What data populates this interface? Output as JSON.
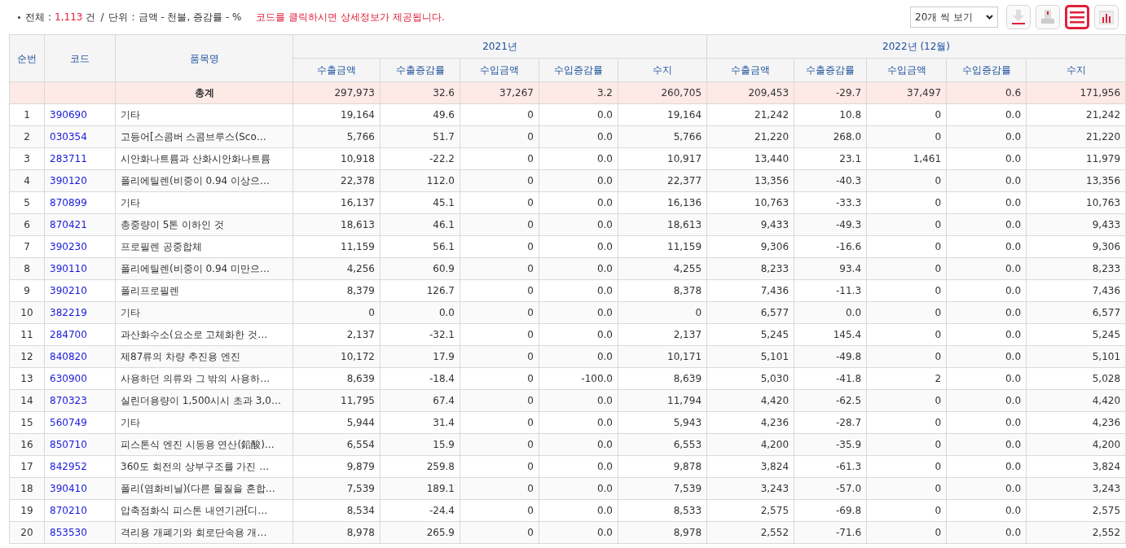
{
  "summary": {
    "total_label": "전체",
    "colon": ":",
    "slash": "/",
    "total_count": "1,113",
    "count_unit": "건",
    "unit_label": "단위",
    "unit_text": "금액 - 천불, 증감률 - %",
    "notice": "코드를 클릭하시면 상세정보가 제공됩니다."
  },
  "page_size_select": {
    "value": "20개 씩 보기"
  },
  "toolbar": [
    {
      "kind": "download",
      "selected": false
    },
    {
      "kind": "print",
      "selected": false
    },
    {
      "kind": "list",
      "selected": true
    },
    {
      "kind": "chart",
      "selected": false
    }
  ],
  "table": {
    "columns": [
      "순번",
      "코드",
      "품목명"
    ],
    "groups": [
      {
        "label": "2021년",
        "columns": [
          "수출금액",
          "수출증감률",
          "수입금액",
          "수입증감률",
          "수지"
        ]
      },
      {
        "label": "2022년 (12월)",
        "columns": [
          "수출금액",
          "수출증감률",
          "수입금액",
          "수입증감률",
          "수지"
        ]
      }
    ],
    "total_row": {
      "label": "총계",
      "values": [
        "297,973",
        "32.6",
        "37,267",
        "3.2",
        "260,705",
        "209,453",
        "-29.7",
        "37,497",
        "0.6",
        "171,956"
      ]
    },
    "rows": [
      {
        "no": "1",
        "code": "390690",
        "name": "기타",
        "values": [
          "19,164",
          "49.6",
          "0",
          "0.0",
          "19,164",
          "21,242",
          "10.8",
          "0",
          "0.0",
          "21,242"
        ]
      },
      {
        "no": "2",
        "code": "030354",
        "name": "고등어[스콤버 스콤브루스(Sco…",
        "values": [
          "5,766",
          "51.7",
          "0",
          "0.0",
          "5,766",
          "21,220",
          "268.0",
          "0",
          "0.0",
          "21,220"
        ]
      },
      {
        "no": "3",
        "code": "283711",
        "name": "시안화나트륨과 산화시안화나트륨",
        "values": [
          "10,918",
          "-22.2",
          "0",
          "0.0",
          "10,917",
          "13,440",
          "23.1",
          "1,461",
          "0.0",
          "11,979"
        ]
      },
      {
        "no": "4",
        "code": "390120",
        "name": "폴리에틸렌(비중이 0.94 이상으…",
        "values": [
          "22,378",
          "112.0",
          "0",
          "0.0",
          "22,377",
          "13,356",
          "-40.3",
          "0",
          "0.0",
          "13,356"
        ]
      },
      {
        "no": "5",
        "code": "870899",
        "name": "기타",
        "values": [
          "16,137",
          "45.1",
          "0",
          "0.0",
          "16,136",
          "10,763",
          "-33.3",
          "0",
          "0.0",
          "10,763"
        ]
      },
      {
        "no": "6",
        "code": "870421",
        "name": "총중량이 5톤 이하인 것",
        "values": [
          "18,613",
          "46.1",
          "0",
          "0.0",
          "18,613",
          "9,433",
          "-49.3",
          "0",
          "0.0",
          "9,433"
        ]
      },
      {
        "no": "7",
        "code": "390230",
        "name": "프로필렌 공중합체",
        "values": [
          "11,159",
          "56.1",
          "0",
          "0.0",
          "11,159",
          "9,306",
          "-16.6",
          "0",
          "0.0",
          "9,306"
        ]
      },
      {
        "no": "8",
        "code": "390110",
        "name": "폴리에틸렌(비중이 0.94 미만으…",
        "values": [
          "4,256",
          "60.9",
          "0",
          "0.0",
          "4,255",
          "8,233",
          "93.4",
          "0",
          "0.0",
          "8,233"
        ]
      },
      {
        "no": "9",
        "code": "390210",
        "name": "폴리프로필렌",
        "values": [
          "8,379",
          "126.7",
          "0",
          "0.0",
          "8,378",
          "7,436",
          "-11.3",
          "0",
          "0.0",
          "7,436"
        ]
      },
      {
        "no": "10",
        "code": "382219",
        "name": "기타",
        "values": [
          "0",
          "0.0",
          "0",
          "0.0",
          "0",
          "6,577",
          "0.0",
          "0",
          "0.0",
          "6,577"
        ]
      },
      {
        "no": "11",
        "code": "284700",
        "name": "과산화수소(요소로 고체화한 것…",
        "values": [
          "2,137",
          "-32.1",
          "0",
          "0.0",
          "2,137",
          "5,245",
          "145.4",
          "0",
          "0.0",
          "5,245"
        ]
      },
      {
        "no": "12",
        "code": "840820",
        "name": "제87류의 차량 추진용 엔진",
        "values": [
          "10,172",
          "17.9",
          "0",
          "0.0",
          "10,171",
          "5,101",
          "-49.8",
          "0",
          "0.0",
          "5,101"
        ]
      },
      {
        "no": "13",
        "code": "630900",
        "name": "사용하던 의류와 그 밖의 사용하…",
        "values": [
          "8,639",
          "-18.4",
          "0",
          "-100.0",
          "8,639",
          "5,030",
          "-41.8",
          "2",
          "0.0",
          "5,028"
        ]
      },
      {
        "no": "14",
        "code": "870323",
        "name": "실린더용량이 1,500시시 초과 3,0…",
        "values": [
          "11,795",
          "67.4",
          "0",
          "0.0",
          "11,794",
          "4,420",
          "-62.5",
          "0",
          "0.0",
          "4,420"
        ]
      },
      {
        "no": "15",
        "code": "560749",
        "name": "기타",
        "values": [
          "5,944",
          "31.4",
          "0",
          "0.0",
          "5,943",
          "4,236",
          "-28.7",
          "0",
          "0.0",
          "4,236"
        ]
      },
      {
        "no": "16",
        "code": "850710",
        "name": "피스톤식 엔진 시동용 연산(鉛酸)…",
        "values": [
          "6,554",
          "15.9",
          "0",
          "0.0",
          "6,553",
          "4,200",
          "-35.9",
          "0",
          "0.0",
          "4,200"
        ]
      },
      {
        "no": "17",
        "code": "842952",
        "name": "360도 회전의 상부구조를 가진 …",
        "values": [
          "9,879",
          "259.8",
          "0",
          "0.0",
          "9,878",
          "3,824",
          "-61.3",
          "0",
          "0.0",
          "3,824"
        ]
      },
      {
        "no": "18",
        "code": "390410",
        "name": "폴리(염화비닐)(다른 물질을 혼합…",
        "values": [
          "7,539",
          "189.1",
          "0",
          "0.0",
          "7,539",
          "3,243",
          "-57.0",
          "0",
          "0.0",
          "3,243"
        ]
      },
      {
        "no": "19",
        "code": "870210",
        "name": "압축점화식 피스톤 내연기관[디…",
        "values": [
          "8,534",
          "-24.4",
          "0",
          "0.0",
          "8,533",
          "2,575",
          "-69.8",
          "0",
          "0.0",
          "2,575"
        ]
      },
      {
        "no": "20",
        "code": "853530",
        "name": "격리용 개폐기와 회로단속용 개…",
        "values": [
          "8,978",
          "265.9",
          "0",
          "0.0",
          "8,978",
          "2,552",
          "-71.6",
          "0",
          "0.0",
          "2,552"
        ]
      }
    ]
  }
}
